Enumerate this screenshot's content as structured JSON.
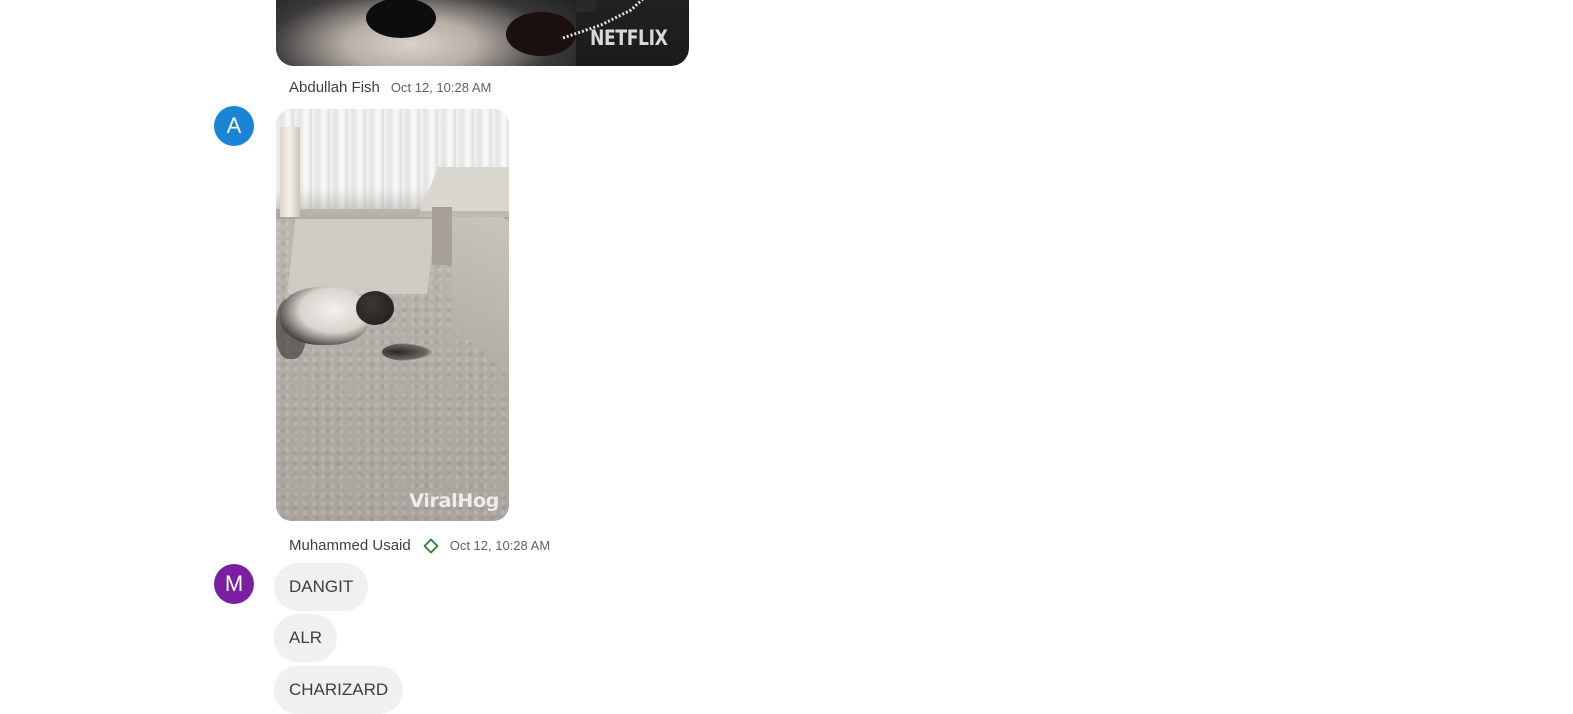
{
  "messages": [
    {
      "attachment": {
        "type": "gif",
        "watermark": "NETFLIX"
      }
    },
    {
      "sender": "Abdullah Fish",
      "timestamp": "Oct 12, 10:28 AM",
      "avatar": {
        "initial": "A",
        "color": "#1a84d6"
      },
      "attachment": {
        "type": "gif",
        "watermark": "ViralHog"
      }
    },
    {
      "sender": "Muhammed Usaid",
      "timestamp": "Oct 12, 10:28 AM",
      "badge_icon": "diamond-outline-icon",
      "avatar": {
        "initial": "M",
        "color": "#7b1fa2"
      },
      "bubbles": [
        "DANGIT",
        "ALR",
        "CHARIZARD"
      ]
    }
  ]
}
